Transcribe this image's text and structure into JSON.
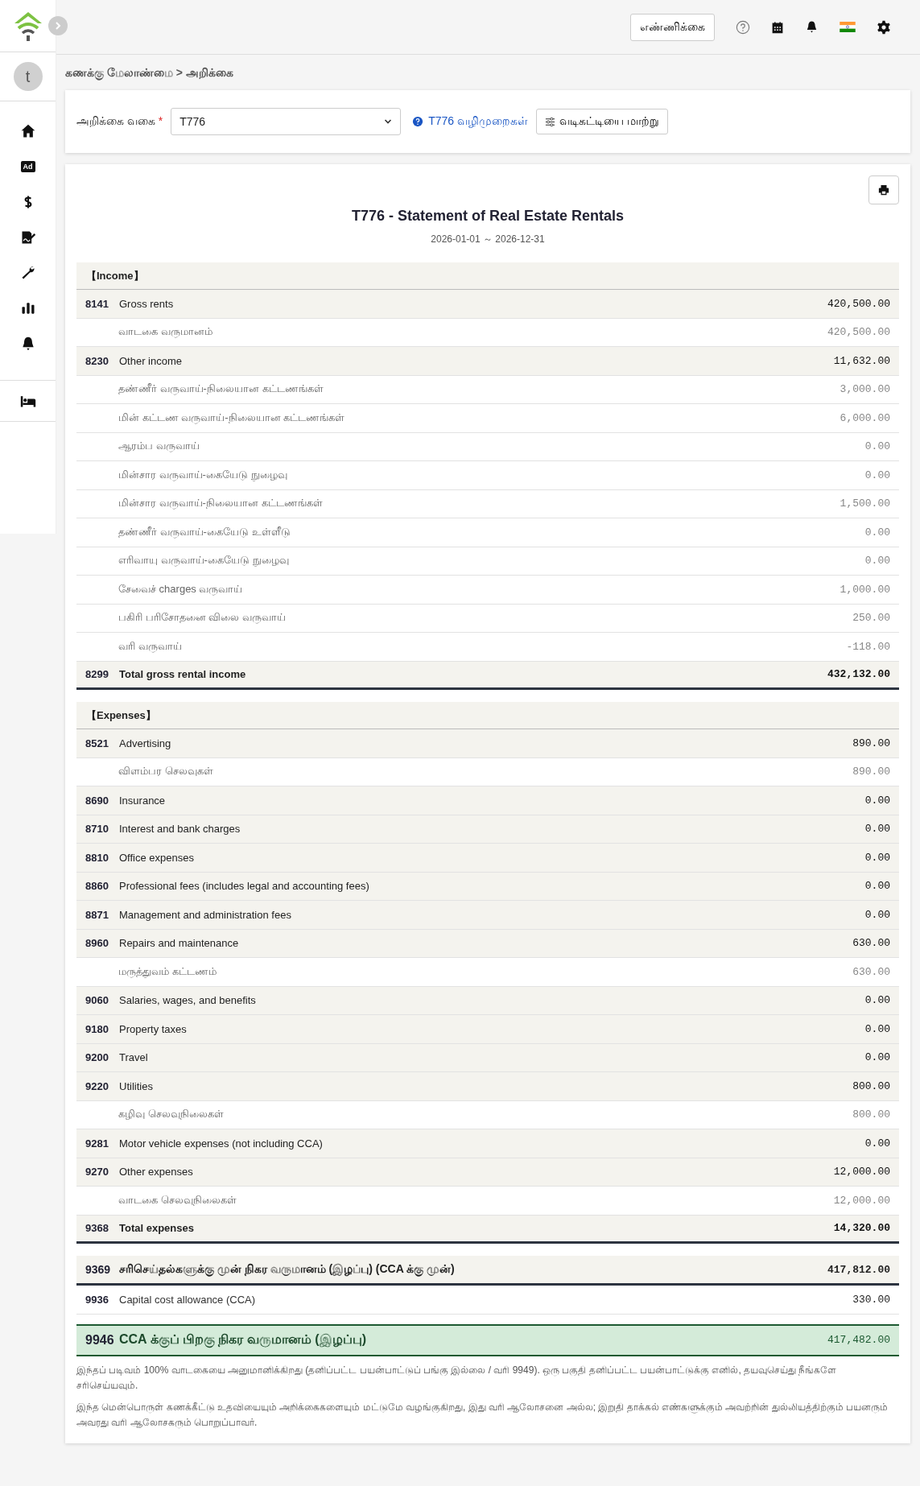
{
  "sidebar": {
    "avatar": "t",
    "items": [
      {
        "kind": "home",
        "selected": false
      },
      {
        "kind": "ad",
        "text": "Ad",
        "selected": false
      },
      {
        "kind": "dollar",
        "selected": false
      },
      {
        "kind": "sign",
        "selected": false
      },
      {
        "kind": "wrench",
        "selected": false
      },
      {
        "kind": "chart",
        "selected": false
      },
      {
        "kind": "bell",
        "selected": false
      }
    ],
    "bottom_items": [
      {
        "kind": "bed",
        "selected": false
      }
    ]
  },
  "top_bar": {
    "count_button": "எண்ணிக்கை"
  },
  "breadcrumb": "கணக்கு மேலாண்மை > அறிக்கை",
  "filter": {
    "label": "அறிக்கை வகை",
    "required_mark": "*",
    "select_value": "T776",
    "help_link": "T776 வழிமுறைகள்",
    "layout_button": "வடிகட்டியை மாற்று"
  },
  "report": {
    "title": "T776 - Statement of Real Estate Rentals",
    "period": "2026-01-01 ～ 2026-12-31",
    "sections": [
      {
        "heading": "【Income】",
        "rows": [
          {
            "kind": "account",
            "code": "8141",
            "label": "Gross rents",
            "amount": "420,500.00"
          },
          {
            "kind": "detail",
            "label": "வாடகை வருமானம்",
            "amount": "420,500.00"
          },
          {
            "kind": "account",
            "code": "8230",
            "label": "Other income",
            "amount": "11,632.00"
          },
          {
            "kind": "detail",
            "label": "தண்ணீர் வருவாய்-நிலையான கட்டணங்கள்",
            "amount": "3,000.00"
          },
          {
            "kind": "detail",
            "label": "மின் கட்டண வருவாய்-நிலையான கட்டணங்கள்",
            "amount": "6,000.00"
          },
          {
            "kind": "detail",
            "label": "ஆரம்ப வருவாய்",
            "amount": "0.00"
          },
          {
            "kind": "detail",
            "label": "மின்சார வருவாய்-கையேடு நுழைவு",
            "amount": "0.00"
          },
          {
            "kind": "detail",
            "label": "மின்சார வருவாய்-நிலையான கட்டணங்கள்",
            "amount": "1,500.00"
          },
          {
            "kind": "detail",
            "label": "தண்ணீர் வருவாய்-கையேடு உள்ளீடு",
            "amount": "0.00"
          },
          {
            "kind": "detail",
            "label": "எரிவாயு வருவாய்-கையேடு நுழைவு",
            "amount": "0.00"
          },
          {
            "kind": "detail",
            "label": "சேவைச் charges வருவாய்",
            "amount": "1,000.00"
          },
          {
            "kind": "detail",
            "label": "பகிரி பரிசோதனை விலை வருவாய்",
            "amount": "250.00"
          },
          {
            "kind": "detail",
            "label": "வரி வருவாய்",
            "amount": "-118.00"
          },
          {
            "kind": "total",
            "code": "8299",
            "label": "Total gross rental income",
            "amount": "432,132.00"
          }
        ]
      },
      {
        "heading": "【Expenses】",
        "rows": [
          {
            "kind": "account",
            "code": "8521",
            "label": "Advertising",
            "amount": "890.00"
          },
          {
            "kind": "detail",
            "label": "விளம்பர செலவுகள்",
            "amount": "890.00"
          },
          {
            "kind": "account",
            "code": "8690",
            "label": "Insurance",
            "amount": "0.00"
          },
          {
            "kind": "account",
            "code": "8710",
            "label": "Interest and bank charges",
            "amount": "0.00"
          },
          {
            "kind": "account",
            "code": "8810",
            "label": "Office expenses",
            "amount": "0.00"
          },
          {
            "kind": "account",
            "code": "8860",
            "label": "Professional fees (includes legal and accounting fees)",
            "amount": "0.00"
          },
          {
            "kind": "account",
            "code": "8871",
            "label": "Management and administration fees",
            "amount": "0.00"
          },
          {
            "kind": "account",
            "code": "8960",
            "label": "Repairs and maintenance",
            "amount": "630.00"
          },
          {
            "kind": "detail",
            "label": "மருத்துவம் கட்டணம்",
            "amount": "630.00"
          },
          {
            "kind": "account",
            "code": "9060",
            "label": "Salaries, wages, and benefits",
            "amount": "0.00"
          },
          {
            "kind": "account",
            "code": "9180",
            "label": "Property taxes",
            "amount": "0.00"
          },
          {
            "kind": "account",
            "code": "9200",
            "label": "Travel",
            "amount": "0.00"
          },
          {
            "kind": "account",
            "code": "9220",
            "label": "Utilities",
            "amount": "800.00"
          },
          {
            "kind": "detail",
            "label": "கழிவு செலவுநிலைகள்",
            "amount": "800.00"
          },
          {
            "kind": "account",
            "code": "9281",
            "label": "Motor vehicle expenses (not including CCA)",
            "amount": "0.00"
          },
          {
            "kind": "account",
            "code": "9270",
            "label": "Other expenses",
            "amount": "12,000.00"
          },
          {
            "kind": "detail",
            "label": "வாடகை செலவுநிலைகள்",
            "amount": "12,000.00"
          },
          {
            "kind": "total",
            "code": "9368",
            "label": "Total expenses",
            "amount": "14,320.00"
          }
        ]
      }
    ],
    "summary_rows": [
      {
        "kind": "net",
        "code": "9369",
        "label": "சரிசெய்தல்களுக்கு முன் நிகர வருமானம் (இழப்பு) (CCA க்கு முன்)",
        "amount": "417,812.00"
      },
      {
        "kind": "plain",
        "code": "9936",
        "label": "Capital cost allowance (CCA)",
        "amount": "330.00"
      },
      {
        "kind": "final",
        "code": "9946",
        "label": "CCA க்குப் பிறகு நிகர வருமானம் (இழப்பு)",
        "amount": "417,482.00"
      }
    ],
    "notes": [
      "இந்தப் படிவம் 100% வாடகையை அனுமானிக்கிறது (தனிப்பட்ட பயன்பாட்டுப் பங்கு இல்லை / வரி 9949). ஒரு பகுதி தனிப்பட்ட பயன்பாட்டுக்கு எனில், தயவுசெய்து நீங்களே சரிசெய்யவும்.",
      "இந்த மென்பொருள் கணக்கீட்டு உதவியையும் அறிக்கைகளையும் மட்டுமே வழங்குகிறது, இது வரி ஆலோசனை அல்ல; இறுதி தாக்கல் எண்களுக்கும் அவற்றின் துல்லியத்திற்கும் பயனரும் அவரது வரி ஆலோசகரும் பொறுப்பாவர்."
    ]
  }
}
